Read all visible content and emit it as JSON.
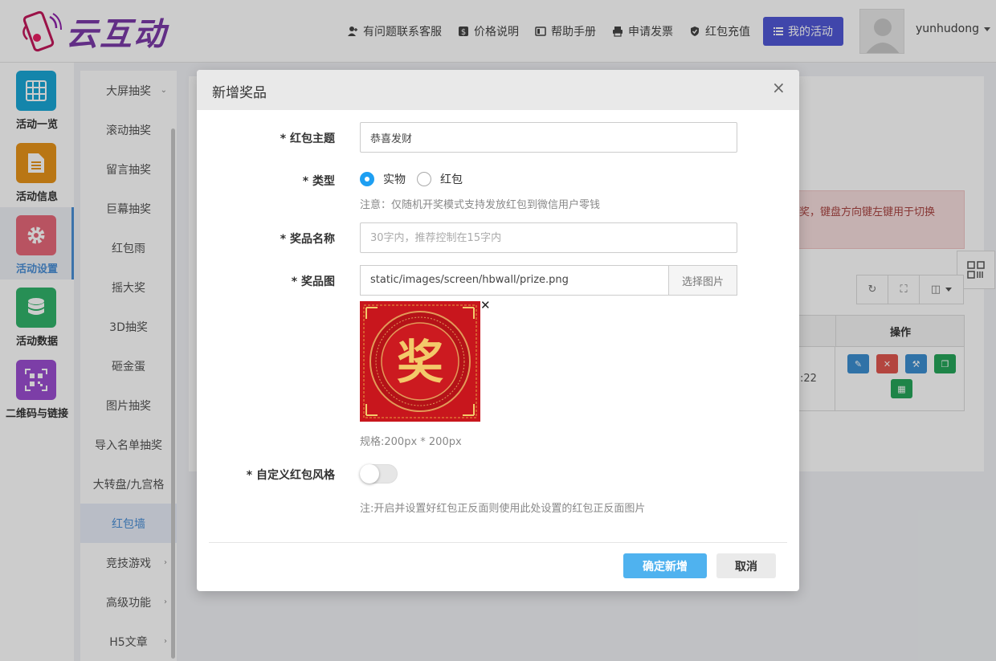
{
  "header": {
    "logo_text": "云互动",
    "nav": [
      {
        "label": "有问题联系客服",
        "icon": "user-plus-icon"
      },
      {
        "label": "价格说明",
        "icon": "dollar-icon"
      },
      {
        "label": "帮助手册",
        "icon": "book-icon"
      },
      {
        "label": "申请发票",
        "icon": "printer-icon"
      },
      {
        "label": "红包充值",
        "icon": "shield-check-icon"
      }
    ],
    "my_activity_label": "我的活动",
    "username": "yunhudong"
  },
  "sidebar": {
    "items": [
      {
        "label": "活动一览",
        "icon": "grid-icon",
        "color": "#1aa7d6"
      },
      {
        "label": "活动信息",
        "icon": "document-icon",
        "color": "#e8941a"
      },
      {
        "label": "活动设置",
        "icon": "gear-icon",
        "color": "#e7687a",
        "active": true
      },
      {
        "label": "活动数据",
        "icon": "database-icon",
        "color": "#31b36b"
      },
      {
        "label": "二维码与链接",
        "icon": "qrcode-icon",
        "color": "#9b4ed1"
      }
    ]
  },
  "submenu": {
    "items": [
      {
        "label": "大屏抽奖",
        "chevron": "down"
      },
      {
        "label": "滚动抽奖"
      },
      {
        "label": "留言抽奖"
      },
      {
        "label": "巨幕抽奖"
      },
      {
        "label": "红包雨"
      },
      {
        "label": "摇大奖"
      },
      {
        "label": "3D抽奖"
      },
      {
        "label": "砸金蛋"
      },
      {
        "label": "图片抽奖"
      },
      {
        "label": "导入名单抽奖"
      },
      {
        "label": "大转盘/九宫格"
      },
      {
        "label": "红包墙",
        "active": true
      },
      {
        "label": "竞技游戏",
        "chevron": "right"
      },
      {
        "label": "高级功能",
        "chevron": "right"
      },
      {
        "label": "H5文章",
        "chevron": "right"
      }
    ]
  },
  "background": {
    "alert_text": "奖，键盘方向键左键用于切换",
    "table_header_op": "操作",
    "row_time": ":22"
  },
  "modal": {
    "title": "新增奖品",
    "fields": {
      "theme": {
        "label": "* 红包主题",
        "value": "恭喜发财"
      },
      "type": {
        "label": "* 类型",
        "options": [
          "实物",
          "红包"
        ],
        "selected": "实物",
        "note": "注意：仅随机开奖模式支持发放红包到微信用户零钱"
      },
      "prize_name": {
        "label": "* 奖品名称",
        "value": "",
        "placeholder": "30字内，推荐控制在15字内"
      },
      "prize_image": {
        "label": "* 奖品图",
        "path": "static/images/screen/hbwall/prize.png",
        "choose_label": "选择图片",
        "image_char": "奖",
        "spec": "规格:200px * 200px"
      },
      "custom_style": {
        "label": "* 自定义红包风格",
        "enabled": false,
        "note": "注:开启并设置好红包正反面则使用此处设置的红包正反面图片"
      }
    },
    "buttons": {
      "confirm": "确定新增",
      "cancel": "取消"
    }
  },
  "colors": {
    "accent": "#4fb2ef",
    "nav_button": "#5058d6",
    "prize_red": "#c8161d",
    "prize_gold": "#f3c96a"
  }
}
